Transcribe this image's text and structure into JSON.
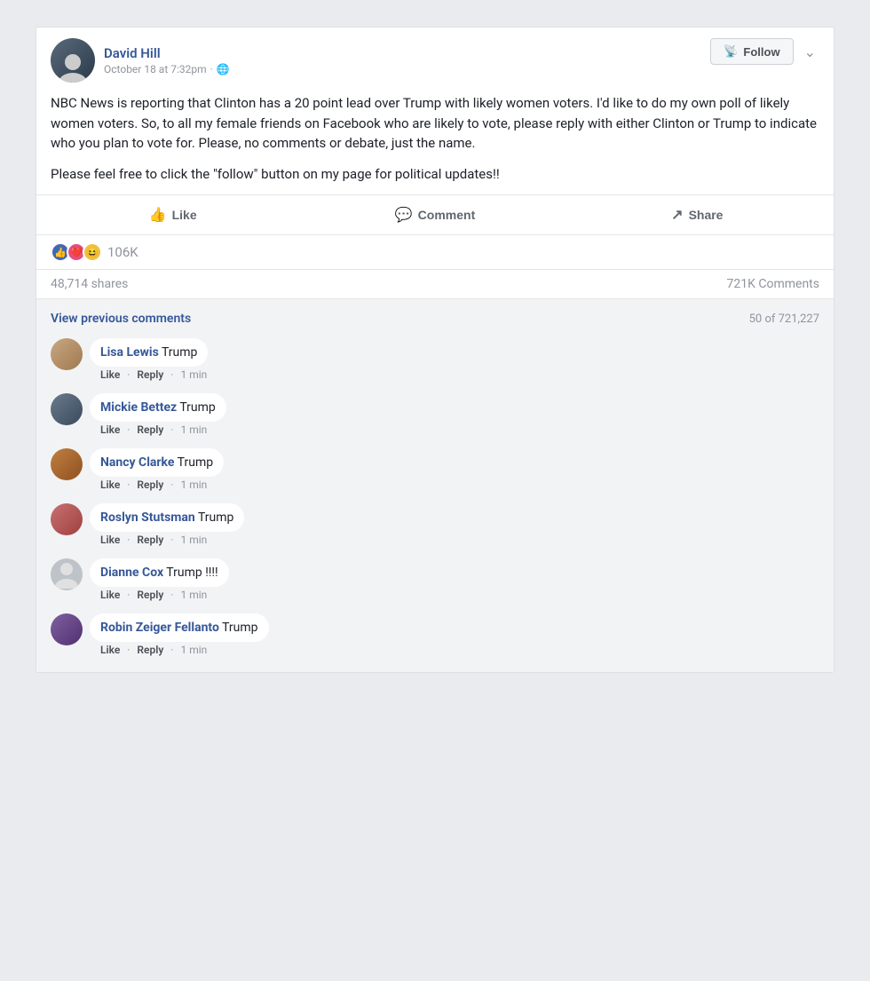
{
  "post": {
    "author": "David Hill",
    "timestamp": "October 18 at 7:32pm",
    "visibility_icon": "🌐",
    "follow_label": "Follow",
    "body_paragraph1": "NBC News is reporting that Clinton has a 20 point lead over Trump with likely women voters. I'd like to do my own poll of likely women voters. So, to all my female friends on Facebook who are likely to vote, please reply with either Clinton or Trump to indicate who you plan to vote for. Please, no comments or debate, just the name.",
    "body_paragraph2": "Please feel free to click the \"follow\" button on my page for political updates!!",
    "actions": {
      "like": "Like",
      "comment": "Comment",
      "share": "Share"
    },
    "reactions": {
      "count": "106K"
    },
    "shares": "48,714 shares",
    "comments_count": "721K Comments",
    "view_previous": "View previous comments",
    "pagination": "50 of 721,227",
    "comments": [
      {
        "id": 1,
        "name": "Lisa Lewis",
        "text": "Trump",
        "like": "Like",
        "reply": "Reply",
        "time": "1 min",
        "avatar_class": "av-lisa"
      },
      {
        "id": 2,
        "name": "Mickie Bettez",
        "text": "Trump",
        "like": "Like",
        "reply": "Reply",
        "time": "1 min",
        "avatar_class": "av-mickie"
      },
      {
        "id": 3,
        "name": "Nancy Clarke",
        "text": "Trump",
        "like": "Like",
        "reply": "Reply",
        "time": "1 min",
        "avatar_class": "av-nancy"
      },
      {
        "id": 4,
        "name": "Roslyn Stutsman",
        "text": "Trump",
        "like": "Like",
        "reply": "Reply",
        "time": "1 min",
        "avatar_class": "av-roslyn"
      },
      {
        "id": 5,
        "name": "Dianne Cox",
        "text": "Trump !!!!",
        "like": "Like",
        "reply": "Reply",
        "time": "1 min",
        "avatar_class": "av-dianne"
      },
      {
        "id": 6,
        "name": "Robin Zeiger Fellanto",
        "text": "Trump",
        "like": "Like",
        "reply": "Reply",
        "time": "1 min",
        "avatar_class": "av-robin"
      }
    ]
  }
}
